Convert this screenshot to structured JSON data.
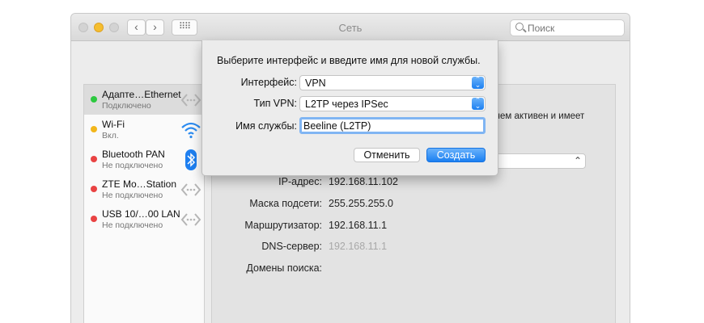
{
  "window": {
    "title": "Сеть"
  },
  "search": {
    "placeholder": "Поиск"
  },
  "sidebar": {
    "items": [
      {
        "name": "Адапте…Ethernet",
        "status": "Подключено",
        "dot": "green",
        "icon": "ethernet-icon"
      },
      {
        "name": "Wi-Fi",
        "status": "Вкл.",
        "dot": "yellow",
        "icon": "wifi-icon"
      },
      {
        "name": "Bluetooth PAN",
        "status": "Не подключено",
        "dot": "red",
        "icon": "bluetooth-icon"
      },
      {
        "name": "ZTE Mo…Station",
        "status": "Не подключено",
        "dot": "red",
        "icon": "ethernet-icon"
      },
      {
        "name": "USB 10/…00 LAN",
        "status": "Не подключено",
        "dot": "red",
        "icon": "ethernet-icon"
      }
    ]
  },
  "content": {
    "status_line1": "чем активен и имеет",
    "status_line2": "",
    "details": [
      {
        "label": "IP-адрес:",
        "value": "192.168.11.102",
        "dim": false
      },
      {
        "label": "Маска подсети:",
        "value": "255.255.255.0",
        "dim": false
      },
      {
        "label": "Маршрутизатор:",
        "value": "192.168.11.1",
        "dim": false
      },
      {
        "label": "DNS-сервер:",
        "value": "192.168.11.1",
        "dim": true
      },
      {
        "label": "Домены поиска:",
        "value": "",
        "dim": false
      }
    ]
  },
  "dialog": {
    "prompt": "Выберите интерфейс и введите имя для новой службы.",
    "interface_label": "Интерфейс:",
    "interface_value": "VPN",
    "vpn_type_label": "Тип VPN:",
    "vpn_type_value": "L2TP через IPSec",
    "service_name_label": "Имя службы:",
    "service_name_value": "Beeline (L2TP)",
    "cancel_label": "Отменить",
    "create_label": "Создать"
  },
  "colors": {
    "accent": "#1b7ff1",
    "status_green": "#2dc940",
    "status_yellow": "#f2b61b",
    "status_red": "#e94343"
  }
}
